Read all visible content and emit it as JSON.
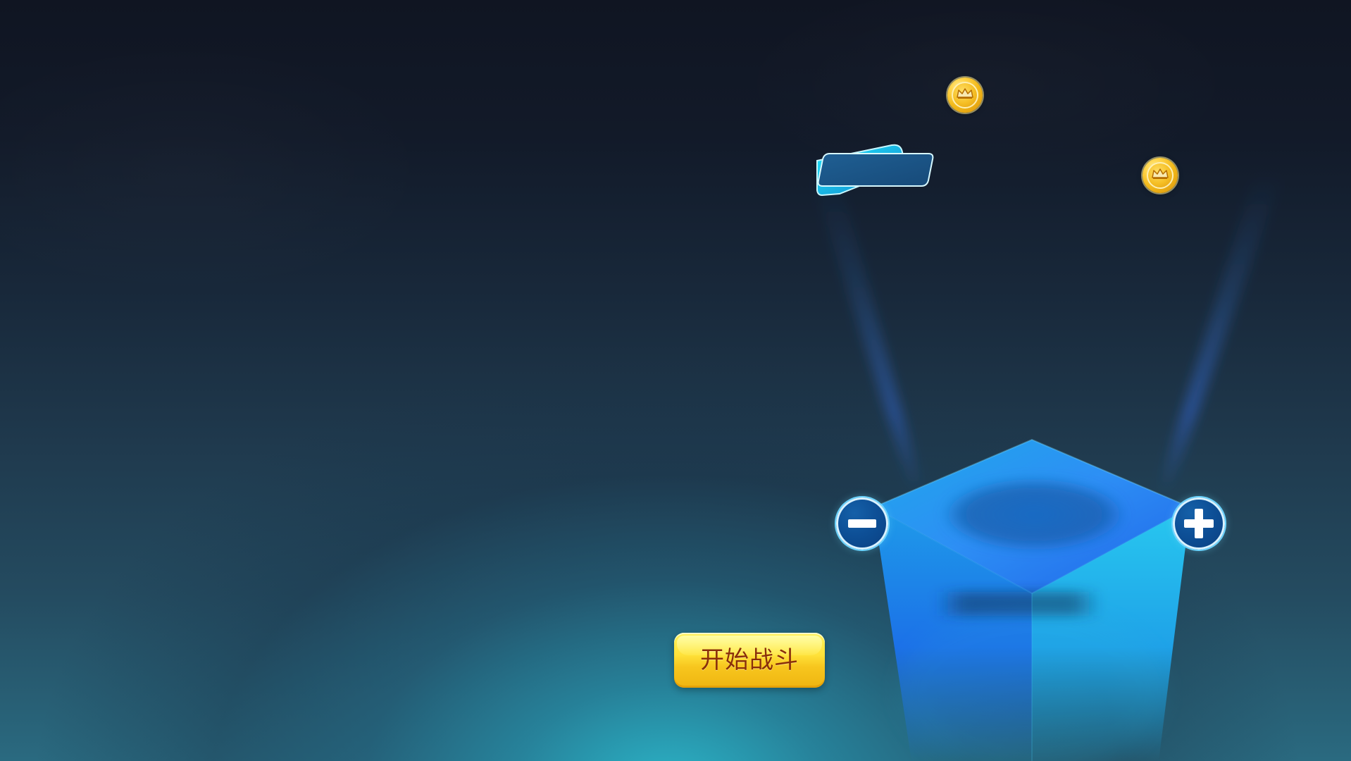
{
  "game_ui": {
    "start_button_label": "开始战斗"
  },
  "icons": {
    "coin_left": "crown-coin-icon",
    "coin_right": "crown-coin-icon",
    "ticket": "ticket-icon",
    "minus": "minus-icon",
    "plus": "plus-icon"
  },
  "colors": {
    "background_top": "#101522",
    "background_glow": "#2bbacd",
    "button_primary": "#ffe23a",
    "button_text": "#8a2f0a",
    "control_button": "#0d4f96",
    "pedestal_blue": "#1d8ff0"
  }
}
